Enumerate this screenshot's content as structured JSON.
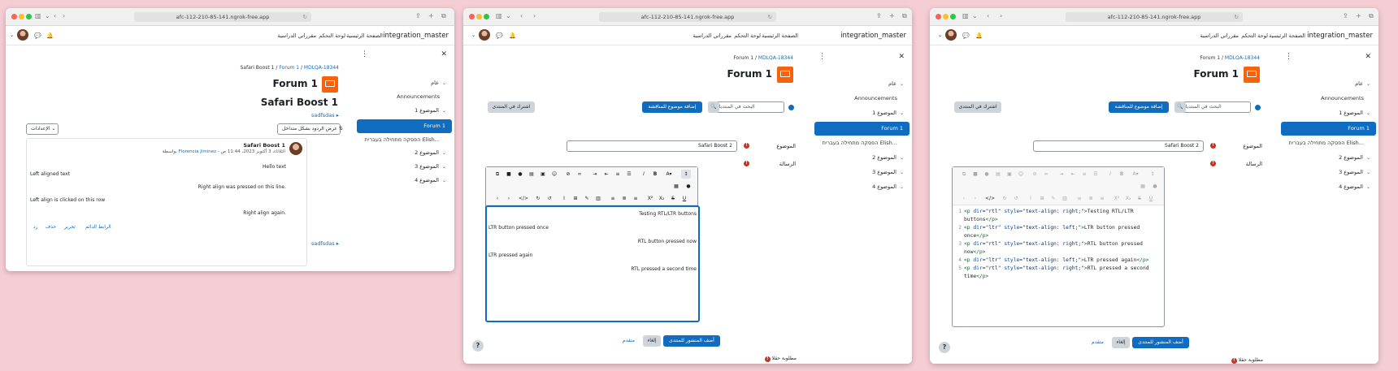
{
  "browser": {
    "url": "afc-112-210-85-141.ngrok-free.app"
  },
  "nav": {
    "brand": "integration_master",
    "home": "الصفحة الرئيسية",
    "dashboard": "لوحة التحكم",
    "courses": "مقرراتي الدراسية"
  },
  "drawer": {
    "general": "عام",
    "announcements": "Announcements",
    "topic1": "الموضوع 1",
    "forum1": "Forum 1",
    "hebrew": "הפסקה מתחילה בעברית Elish...",
    "topic2": "الموضوع 2",
    "topic3": "الموضوع 3",
    "topic4": "الموضوع 4"
  },
  "win1": {
    "breadcrumb": {
      "course": "Safari Boost 1",
      "forum": "Forum 1",
      "id": "MDLQA-18344"
    },
    "title": "Forum 1",
    "discussion_title": "Safari Boost 1",
    "thread_link": "sadfsdas",
    "display_mode": "عرض الردود بشكل متداخل",
    "settings": "الإعدادات",
    "post": {
      "subject": "Safari Boost 1",
      "author_prefix": "بواسطة",
      "author": "Florencia Jiminez",
      "date": "الثلاثاء، 3 أكتوبر 2023، 11:44 ص",
      "lines": [
        "Hello text",
        "Left aligned text",
        "Right align was pressed on this line.",
        "Left align is clicked on this row",
        "Right align again."
      ],
      "actions": [
        "الرابط الدائم",
        "تحرير",
        "حذف",
        "رد"
      ]
    },
    "bottom_link": "sadfsdas"
  },
  "win2": {
    "breadcrumb": {
      "forum": "Forum 1",
      "id": "MDLQA-18344"
    },
    "title": "Forum 1",
    "subscribe": "اشترك في المنتدى",
    "add_topic": "إضافة موضوع للمناقشة",
    "search_placeholder": "البحث في المنتديات",
    "subject_label": "الموضوع",
    "subject_value": "Safari Boost 2",
    "message_label": "الرسالة",
    "editor_lines": [
      "Testing RTL/LTR buttons",
      "LTR button pressed once",
      "RTL button pressed now",
      "LTR pressed again",
      "RTL pressed a second time"
    ],
    "post_btn": "أضف المنشور للمنتدى",
    "cancel_btn": "إلغاء",
    "advanced": "متقدم",
    "required": "مطلوبة حقلا"
  },
  "win3": {
    "code_lines": [
      {
        "n": "1",
        "dir": "rtl",
        "align": "right",
        "text": "Testing RTL/LTR",
        "wrap": "buttons"
      },
      {
        "n": "2",
        "dir": "ltr",
        "align": "left",
        "text": "LTR button pressed",
        "wrap": "once"
      },
      {
        "n": "3",
        "dir": "rtl",
        "align": "right",
        "text": "RTL button pressed",
        "wrap": "now"
      },
      {
        "n": "4",
        "dir": "ltr",
        "align": "left",
        "text": "LTR pressed again",
        "wrap": ""
      },
      {
        "n": "5",
        "dir": "rtl",
        "align": "right",
        "text": "RTL pressed a second",
        "wrap": "time"
      }
    ]
  },
  "icons": {
    "bell": "🔔",
    "chat": "💬",
    "close": "✕",
    "more": "⋮",
    "search": "🔍",
    "question": "?"
  }
}
